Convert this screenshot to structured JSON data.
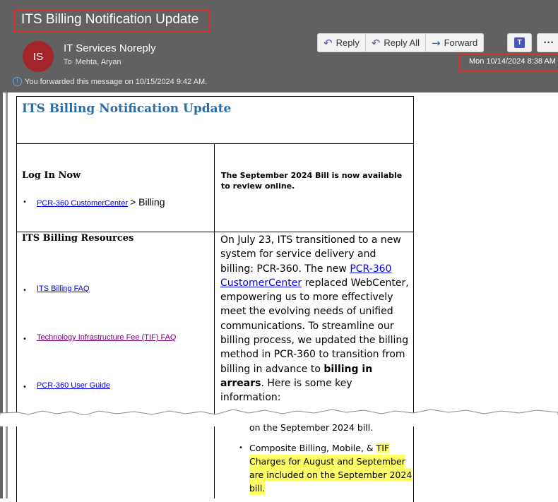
{
  "email": {
    "subject": "ITS Billing Notification Update",
    "sender_initials": "IS",
    "sender_name": "IT Services Noreply",
    "to_label": "To",
    "to_value": "Mehta, Aryan",
    "forward_info": "You forwarded this message on 10/15/2024 9:42 AM.",
    "date": "Mon 10/14/2024 8:38 AM"
  },
  "toolbar": {
    "reply": "Reply",
    "reply_all": "Reply All",
    "forward": "Forward",
    "more": "···"
  },
  "doc": {
    "title": "ITS Billing Notification Update",
    "login_heading": "Log In Now",
    "login_link": "PCR-360 CustomerCenter",
    "login_suffix": "> Billing",
    "sept_message": "The September 2024 Bill is now available to review online.",
    "resources_heading": "ITS Billing Resources",
    "resources": [
      {
        "label": "ITS Billing FAQ"
      },
      {
        "label": "Technology Infrastructure Fee (TIF) FAQ"
      },
      {
        "label": "PCR-360 User Guide"
      }
    ],
    "para_1": "On July 23, ITS transitioned to a new system for service delivery and billing: PCR-360. The new ",
    "para_link": "PCR-360 CustomerCenter",
    "para_2": " replaced WebCenter, empowering us to more effectively meet the evolving needs of unified communications. To streamline our billing process, we updated the billing method in PCR-360 to transition from billing in advance to ",
    "para_bold": "billing in arrears",
    "para_3": ". Here is some key information:",
    "bullet_1_tail": "on the September 2024 bill.",
    "bullet_2_a": "Composite Billing, Mobile, & ",
    "bullet_2_hl_1": "TIF",
    "bullet_2_hl_2": "Charges for August and September",
    "bullet_2_hl_3": "are included on the September 2024",
    "bullet_2_hl_4": "bill."
  }
}
